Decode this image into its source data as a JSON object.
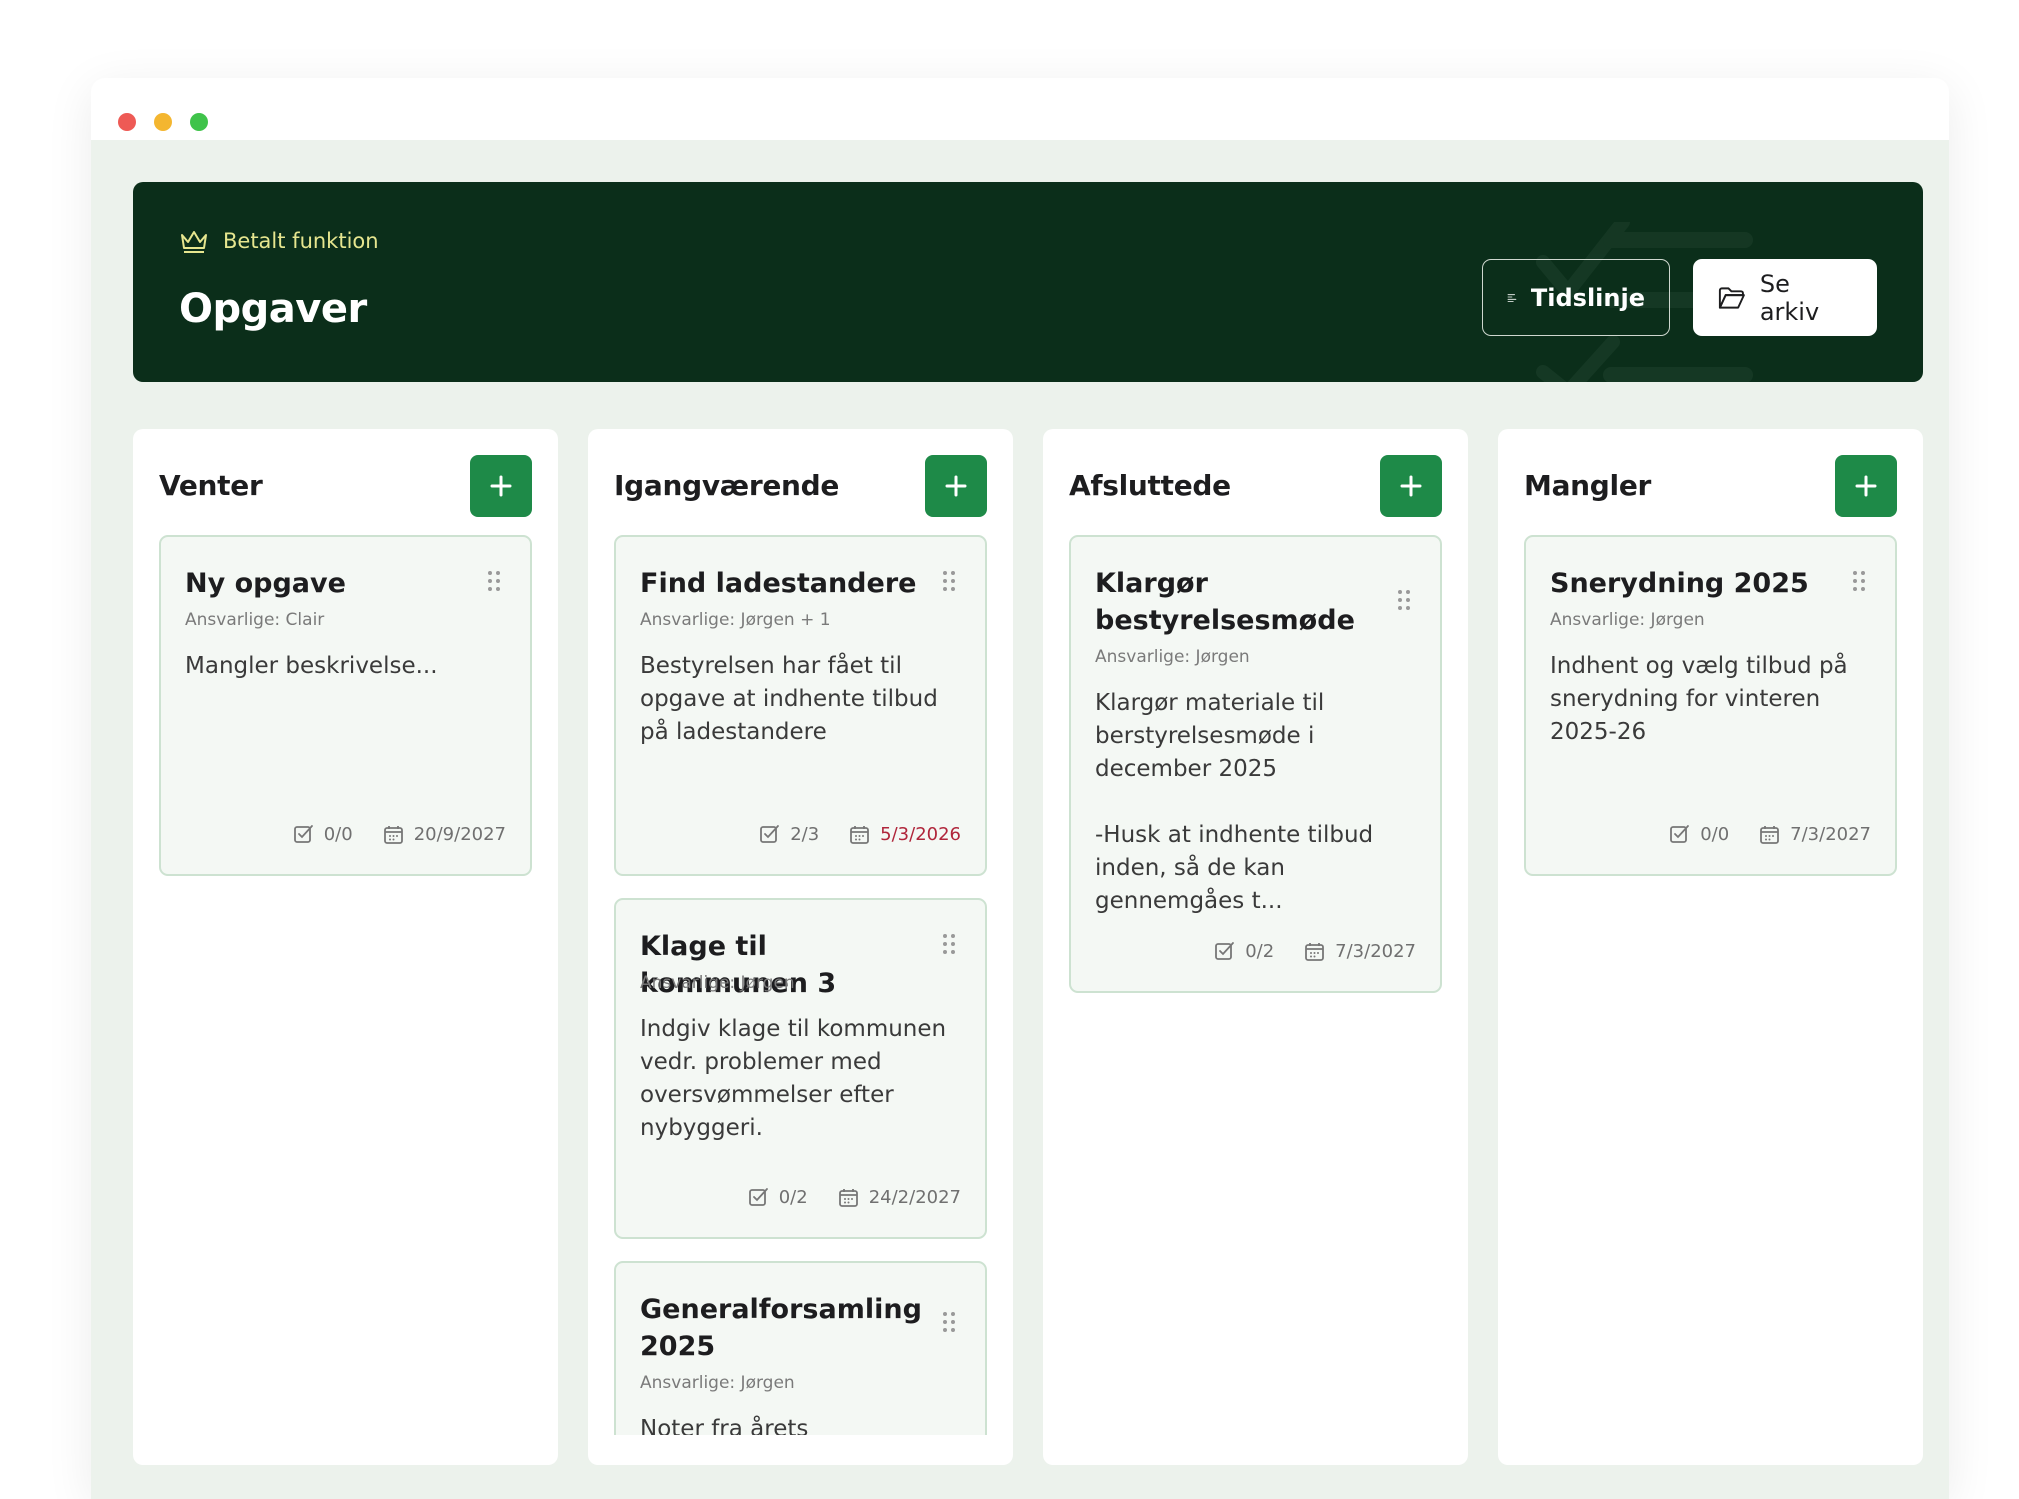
{
  "header": {
    "badge": "Betalt funktion",
    "title": "Opgaver",
    "timeline_button": "Tidslinje",
    "archive_button": "Se arkiv"
  },
  "columns": [
    {
      "title": "Venter",
      "cards": [
        {
          "title": "Ny opgave",
          "assignee": "Ansvarlige: Clair",
          "description": "Mangler beskrivelse...",
          "checklist": "0/0",
          "date": "20/9/2027"
        }
      ]
    },
    {
      "title": "Igangværende",
      "cards": [
        {
          "title": "Find ladestandere",
          "assignee": "Ansvarlige: Jørgen + 1",
          "description": "Bestyrelsen har fået til opgave at indhente tilbud på ladestandere",
          "checklist": "2/3",
          "date": "5/3/2026",
          "overdue": true
        },
        {
          "title": "Klage til kommunen 3",
          "assignee": "Ansvarlige: Jørgen",
          "description": "Indgiv klage til kommunen vedr. problemer med oversvømmelser efter nybyggeri.",
          "checklist": "0/2",
          "date": "24/2/2027"
        },
        {
          "title": "Generalforsamling 2025",
          "assignee": "Ansvarlige: Jørgen",
          "description": "Noter fra årets"
        }
      ]
    },
    {
      "title": "Afsluttede",
      "cards": [
        {
          "title": "Klargør bestyrelsesmøde",
          "assignee": "Ansvarlige: Jørgen",
          "description_line1": "Klargør materiale til berstyrelsesmøde i december 2025",
          "description_line2": "-Husk at indhente tilbud inden, så de kan gennemgåes t...",
          "checklist": "0/2",
          "date": "7/3/2027"
        }
      ]
    },
    {
      "title": "Mangler",
      "cards": [
        {
          "title": "Snerydning 2025",
          "assignee": "Ansvarlige: Jørgen",
          "description": "Indhent og vælg tilbud på snerydning for vinteren 2025-26",
          "checklist": "0/0",
          "date": "7/3/2027"
        }
      ]
    }
  ],
  "colors": {
    "header_bg": "#0b2e1a",
    "accent_green": "#1e8a48",
    "badge_yellow": "#e6e68f",
    "overdue_red": "#b0263b",
    "content_bg": "#ecf2ec"
  },
  "icons": [
    "crown-icon",
    "timeline-icon",
    "folder-icon",
    "plus-icon",
    "drag-handle-icon",
    "checkbox-icon",
    "calendar-icon"
  ]
}
